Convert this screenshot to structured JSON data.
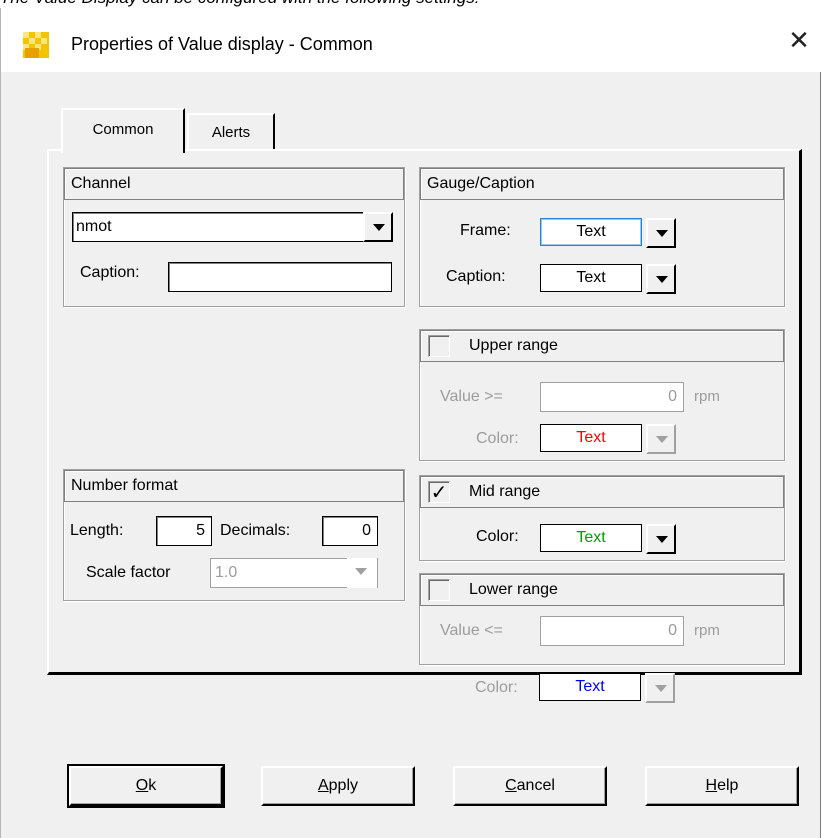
{
  "above_caption": "The Value Display can be configured with the following settings:",
  "window": {
    "title": "Properties of Value display - Common",
    "close_glyph": "✕",
    "icon": "app-icon"
  },
  "tabs": [
    {
      "label": "Common",
      "active": true
    },
    {
      "label": "Alerts",
      "active": false
    }
  ],
  "channel": {
    "header": "Channel",
    "value": "nmot",
    "caption_label": "Caption:",
    "caption_value": ""
  },
  "gauge_caption": {
    "header": "Gauge/Caption",
    "frame_label": "Frame:",
    "frame_value": "Text",
    "frame_color": "#000000",
    "caption_label": "Caption:",
    "caption_value": "Text",
    "caption_color": "#000000"
  },
  "upper_range": {
    "header": "Upper range",
    "checked": false,
    "value_label": "Value >=",
    "value": "0",
    "unit": "rpm",
    "color_label": "Color:",
    "color_text": "Text",
    "color": "#ff0000"
  },
  "mid_range": {
    "header": "Mid range",
    "checked": true,
    "check_glyph": "✓",
    "color_label": "Color:",
    "color_text": "Text",
    "color": "#00a000"
  },
  "lower_range": {
    "header": "Lower range",
    "checked": false,
    "value_label": "Value <=",
    "value": "0",
    "unit": "rpm",
    "color_label": "Color:",
    "color_text": "Text",
    "color": "#0000ff"
  },
  "number_format": {
    "header": "Number format",
    "length_label": "Length:",
    "length": "5",
    "decimals_label": "Decimals:",
    "decimals": "0",
    "scale_label": "Scale factor",
    "scale_value": "1.0"
  },
  "buttons": {
    "ok": {
      "mnemonic": "O",
      "rest": "k"
    },
    "apply": {
      "mnemonic": "A",
      "rest": "pply"
    },
    "cancel": {
      "mnemonic": "C",
      "rest": "ancel"
    },
    "help": {
      "mnemonic": "H",
      "rest": "elp"
    }
  }
}
